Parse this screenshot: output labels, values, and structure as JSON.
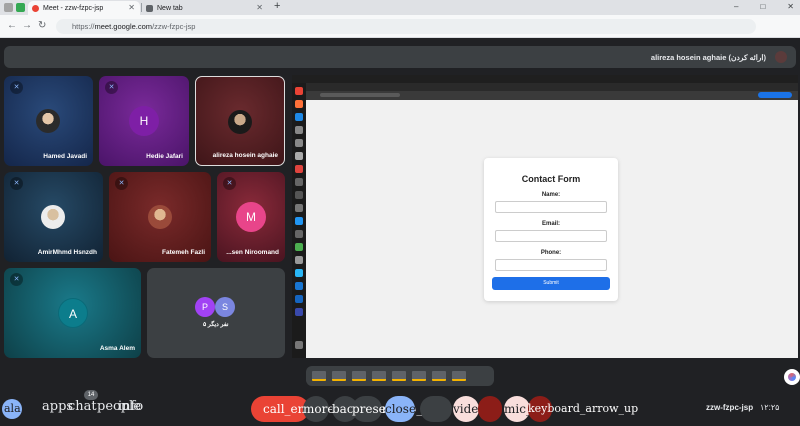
{
  "browser": {
    "tabs": [
      {
        "title": "Meet - zzw-fzpc-jsp",
        "active": true
      },
      {
        "title": "New tab",
        "active": false
      }
    ],
    "new_tab_symbol": "+",
    "window_controls": [
      "–",
      "□",
      "✕"
    ],
    "address": {
      "scheme": "https://",
      "host": "meet.google.com",
      "path": "/zzw-fzpc-jsp"
    }
  },
  "presenter": {
    "name": "alireza hosein aghaie (ارائه‌ کردن)"
  },
  "tiles": [
    {
      "name": "Hamed Javadi",
      "avatar": "photo",
      "muted": true
    },
    {
      "name": "Hedie Jafari",
      "avatar": "letter",
      "letter": "H",
      "muted": true
    },
    {
      "name": "alireza hosein aghaie",
      "avatar": "photo",
      "muted": false
    },
    {
      "name": "AmirMhmd Hsnzdh",
      "avatar": "photo",
      "muted": true
    },
    {
      "name": "Fatemeh Fazli",
      "avatar": "photo",
      "muted": true
    },
    {
      "name": "...sen Niroomand",
      "avatar": "letter",
      "letter": "M",
      "muted": true
    },
    {
      "name": "Asma Alem",
      "avatar": "letter",
      "letter": "A",
      "muted": true
    },
    {
      "name": "۵ نفر دیگر",
      "avatar": "group",
      "letters": [
        "P",
        "S"
      ],
      "muted": false
    }
  ],
  "shared_screen": {
    "form": {
      "title": "Contact Form",
      "labels": {
        "name": "Name:",
        "email": "Email:",
        "phone": "Phone:"
      },
      "submit": "Submit"
    }
  },
  "bottom": {
    "left_icons": {
      "ala": "ala",
      "apps": "apps",
      "chat": "chat",
      "people": "people",
      "info": "info"
    },
    "people_badge": "14",
    "controls": {
      "call": "call_end",
      "more": "more_vert",
      "hand": "back_hand",
      "present": "present_to_all",
      "cc": "closed_caption_off",
      "video": "videocam_off",
      "mic": "mic_off",
      "arrow": "keyboard_arrow_up"
    },
    "meeting_code": "zzw-fzpc-jsp",
    "time": "۱۲:۲۵"
  },
  "colors": {
    "bg": "#202124",
    "danger": "#ea4335",
    "accent": "#8ab4f8"
  }
}
